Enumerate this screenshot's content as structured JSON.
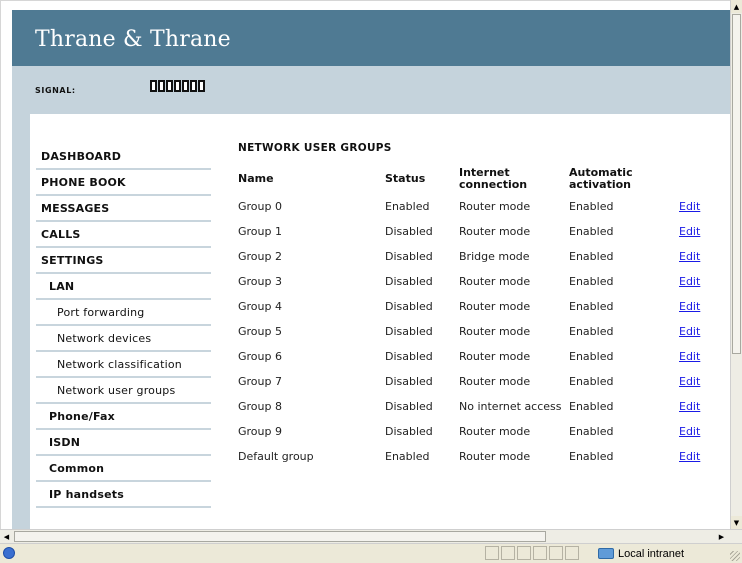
{
  "brand": "Thrane & Thrane",
  "signal": {
    "label": "SIGNAL:",
    "level": 0,
    "max": 7
  },
  "nav": [
    {
      "label": "DASHBOARD",
      "level": 1
    },
    {
      "label": "PHONE BOOK",
      "level": 1
    },
    {
      "label": "MESSAGES",
      "level": 1
    },
    {
      "label": "CALLS",
      "level": 1
    },
    {
      "label": "SETTINGS",
      "level": 1
    },
    {
      "label": "LAN",
      "level": 2
    },
    {
      "label": "Port forwarding",
      "level": 3
    },
    {
      "label": "Network devices",
      "level": 3
    },
    {
      "label": "Network classification",
      "level": 3
    },
    {
      "label": "Network user groups",
      "level": 3
    },
    {
      "label": "Phone/Fax",
      "level": 2
    },
    {
      "label": "ISDN",
      "level": 2
    },
    {
      "label": "Common",
      "level": 2
    },
    {
      "label": "IP handsets",
      "level": 2
    }
  ],
  "content": {
    "title": "NETWORK USER GROUPS",
    "columns": [
      "Name",
      "Status",
      "Internet\nconnection",
      "Automatic\nactivation",
      ""
    ],
    "edit_label": "Edit",
    "rows": [
      {
        "name": "Group 0",
        "status": "Enabled",
        "internet": "Router mode",
        "activation": "Enabled"
      },
      {
        "name": "Group 1",
        "status": "Disabled",
        "internet": "Router mode",
        "activation": "Enabled"
      },
      {
        "name": "Group 2",
        "status": "Disabled",
        "internet": "Bridge mode",
        "activation": "Enabled"
      },
      {
        "name": "Group 3",
        "status": "Disabled",
        "internet": "Router mode",
        "activation": "Enabled"
      },
      {
        "name": "Group 4",
        "status": "Disabled",
        "internet": "Router mode",
        "activation": "Enabled"
      },
      {
        "name": "Group 5",
        "status": "Disabled",
        "internet": "Router mode",
        "activation": "Enabled"
      },
      {
        "name": "Group 6",
        "status": "Disabled",
        "internet": "Router mode",
        "activation": "Enabled"
      },
      {
        "name": "Group 7",
        "status": "Disabled",
        "internet": "Router mode",
        "activation": "Enabled"
      },
      {
        "name": "Group 8",
        "status": "Disabled",
        "internet": "No internet access",
        "activation": "Enabled"
      },
      {
        "name": "Group 9",
        "status": "Disabled",
        "internet": "Router mode",
        "activation": "Enabled"
      },
      {
        "name": "Default group",
        "status": "Enabled",
        "internet": "Router mode",
        "activation": "Enabled"
      }
    ]
  },
  "statusbar": {
    "zone": "Local intranet"
  },
  "colors": {
    "banner": "#4f7a93",
    "signal_band": "#c5d3dc",
    "link": "#1a1ae6"
  }
}
